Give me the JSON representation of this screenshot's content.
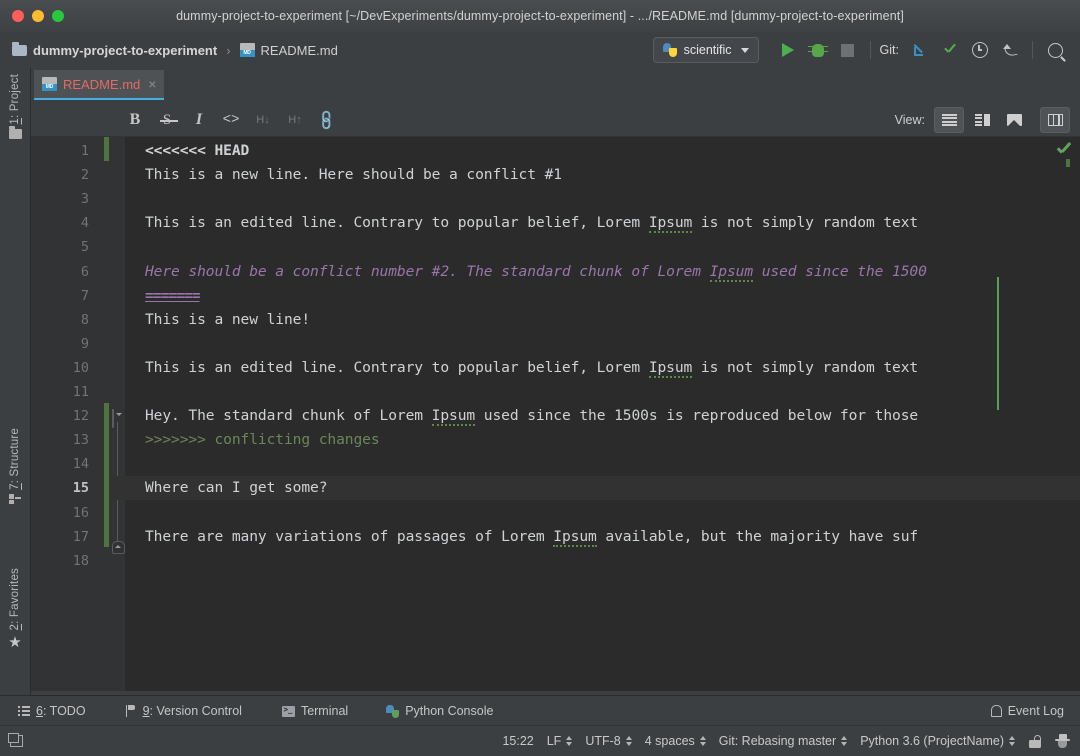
{
  "window": {
    "title": "dummy-project-to-experiment [~/DevExperiments/dummy-project-to-experiment] - .../README.md [dummy-project-to-experiment]",
    "traffic_lights": [
      "close",
      "minimize",
      "zoom"
    ]
  },
  "navbar": {
    "breadcrumb": [
      {
        "label": "dummy-project-to-experiment",
        "icon": "folder-icon"
      },
      {
        "label": "README.md",
        "icon": "markdown-file-icon"
      }
    ],
    "separator": "›",
    "run_config": {
      "label": "scientific",
      "icon": "python-icon"
    },
    "buttons": [
      {
        "name": "run-button",
        "icon": "play-icon"
      },
      {
        "name": "debug-button",
        "icon": "bug-icon"
      },
      {
        "name": "stop-button",
        "icon": "stop-icon"
      }
    ],
    "git_label": "Git:",
    "git_buttons": [
      {
        "name": "update-project-button",
        "icon": "arrow-down-left-icon"
      },
      {
        "name": "commit-button",
        "icon": "check-icon"
      },
      {
        "name": "history-button",
        "icon": "clock-icon"
      },
      {
        "name": "rollback-button",
        "icon": "undo-icon"
      }
    ],
    "search_button": {
      "name": "search-everywhere-button",
      "icon": "magnifier-icon"
    }
  },
  "left_tool_strip": [
    {
      "number": "1",
      "label": ": Project",
      "icon": "project-folder-icon"
    },
    {
      "number": "7",
      "label": ": Structure",
      "icon": "structure-icon"
    },
    {
      "number": "2",
      "label": ": Favorites",
      "icon": "star-icon"
    }
  ],
  "tabs": [
    {
      "label": "README.md",
      "icon": "markdown-file-icon",
      "close": "×",
      "active": true
    }
  ],
  "md_toolbar": {
    "buttons": [
      {
        "name": "bold-button",
        "glyph": "B",
        "enabled": true
      },
      {
        "name": "strikethrough-button",
        "glyph": "S",
        "enabled": true
      },
      {
        "name": "italic-button",
        "glyph": "I",
        "enabled": true
      },
      {
        "name": "code-button",
        "glyph": "<>",
        "enabled": true
      },
      {
        "name": "heading-down-button",
        "glyph": "H↓",
        "enabled": false
      },
      {
        "name": "heading-up-button",
        "glyph": "H↑",
        "enabled": false
      },
      {
        "name": "link-button",
        "glyph": "🔗",
        "enabled": false
      }
    ],
    "view_label": "View:",
    "view_buttons": [
      {
        "name": "view-editor-only-button",
        "icon": "lines-icon",
        "active": true
      },
      {
        "name": "view-editor-preview-button",
        "icon": "split-icon",
        "active": false
      },
      {
        "name": "view-preview-only-button",
        "icon": "image-icon",
        "active": false
      },
      {
        "name": "view-columns-button",
        "icon": "columns-icon",
        "active": true
      }
    ]
  },
  "editor": {
    "lines": [
      {
        "num": "1",
        "segments": [
          {
            "text": "<<<<<<< HEAD",
            "style": "marker"
          }
        ]
      },
      {
        "num": "2",
        "segments": [
          {
            "text": "This is a new line. Here should be a conflict #1",
            "style": "white"
          }
        ]
      },
      {
        "num": "3",
        "segments": []
      },
      {
        "num": "4",
        "segments": [
          {
            "text": "This is an edited line. Contrary to popular belief, Lorem ",
            "style": "white"
          },
          {
            "text": "Ipsum",
            "style": "spell"
          },
          {
            "text": " is not simply random text",
            "style": "white"
          }
        ]
      },
      {
        "num": "5",
        "segments": []
      },
      {
        "num": "6",
        "segments": [
          {
            "text": "Here should be a conflict number #2. The standard chunk of Lorem ",
            "style": "purple"
          },
          {
            "text": "Ipsum",
            "style": "purple-spell"
          },
          {
            "text": " used since the 1500",
            "style": "purple"
          }
        ]
      },
      {
        "num": "7",
        "segments": [
          {
            "text": "=======",
            "style": "eq"
          }
        ]
      },
      {
        "num": "8",
        "segments": [
          {
            "text": "This is a new line!",
            "style": "white"
          }
        ]
      },
      {
        "num": "9",
        "segments": []
      },
      {
        "num": "10",
        "segments": [
          {
            "text": "This is an edited line. Contrary to popular belief, Lorem ",
            "style": "white"
          },
          {
            "text": "Ipsum",
            "style": "spell"
          },
          {
            "text": " is not simply random text",
            "style": "white"
          }
        ]
      },
      {
        "num": "11",
        "segments": []
      },
      {
        "num": "12",
        "segments": [
          {
            "text": "Hey. The standard chunk of Lorem ",
            "style": "white"
          },
          {
            "text": "Ipsum",
            "style": "spell"
          },
          {
            "text": " used since the 1500s is reproduced below for those",
            "style": "white"
          }
        ]
      },
      {
        "num": "13",
        "segments": [
          {
            "text": ">>>>>>> conflicting changes",
            "style": "green"
          }
        ]
      },
      {
        "num": "14",
        "segments": []
      },
      {
        "num": "15",
        "segments": [
          {
            "text": "Where can I get some?",
            "style": "white"
          }
        ],
        "current": true
      },
      {
        "num": "16",
        "segments": []
      },
      {
        "num": "17",
        "segments": [
          {
            "text": "There are many variations of passages of Lorem ",
            "style": "white"
          },
          {
            "text": "Ipsum",
            "style": "spell"
          },
          {
            "text": " available, but the majority have suf",
            "style": "white"
          }
        ]
      },
      {
        "num": "18",
        "segments": []
      }
    ],
    "inspection_status": "ok-check-icon",
    "colors": {
      "background": "#2b2b2b",
      "gutter": "#313335",
      "text": "#cfd2d4",
      "conflict_purple": "#9876aa",
      "conflict_green": "#6a8759",
      "change_marker_green": "#50733f",
      "caret_line_green": "#5a9e5a",
      "current_line": "#323232",
      "tab_underline": "#43b0e3",
      "tab_label": "#e06c65"
    }
  },
  "bottom_bar": {
    "tool_windows": [
      {
        "number": "6",
        "label": ": TODO",
        "icon": "todo-list-icon"
      },
      {
        "number": "9",
        "label": ": Version Control",
        "icon": "branch-icon"
      },
      {
        "number": "",
        "label": "Terminal",
        "icon": "terminal-icon"
      },
      {
        "number": "",
        "label": "Python Console",
        "icon": "python-console-icon"
      }
    ],
    "event_log": {
      "label": "Event Log",
      "icon": "bell-icon"
    }
  },
  "status_bar": {
    "memory_icon": "stack-icon",
    "items": [
      {
        "name": "caret-position",
        "label": "15:22",
        "stepper": false
      },
      {
        "name": "line-separator",
        "label": "LF",
        "stepper": true
      },
      {
        "name": "file-encoding",
        "label": "UTF-8",
        "stepper": true
      },
      {
        "name": "indent-setting",
        "label": "4 spaces",
        "stepper": true
      },
      {
        "name": "git-branch",
        "label": "Git: Rebasing master",
        "stepper": true
      },
      {
        "name": "python-interpreter",
        "label": "Python 3.6 (ProjectName)",
        "stepper": true
      }
    ],
    "lock_icon": "unlocked-padlock-icon",
    "hat_icon": "hector-inspection-icon"
  }
}
